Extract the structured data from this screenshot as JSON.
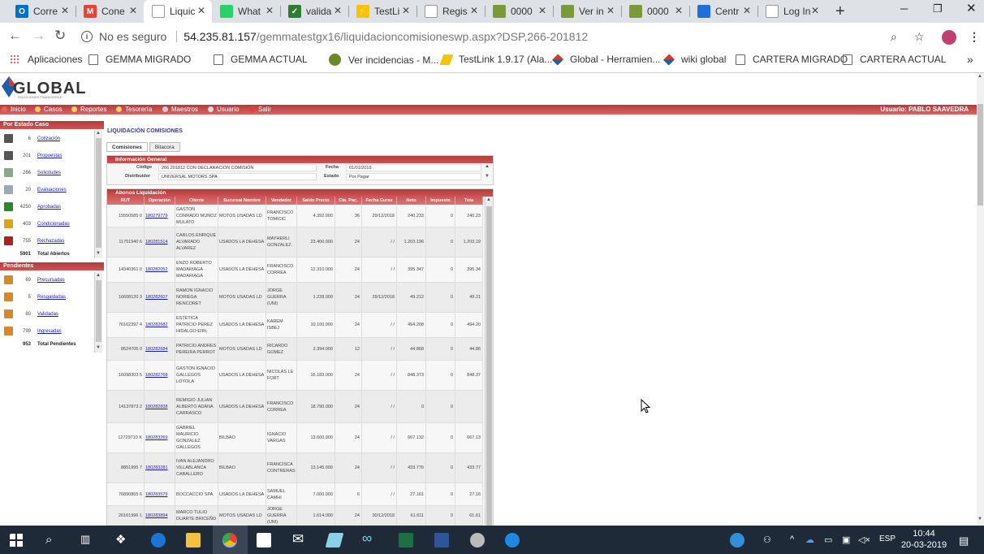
{
  "browser": {
    "tabs": [
      {
        "label": "Corre",
        "fav_color": "#0072c6",
        "fav_text": "O"
      },
      {
        "label": "Cone",
        "fav_color": "#ea4335",
        "fav_text": "M"
      },
      {
        "label": "Liquic",
        "fav_color": "#ffffff",
        "fav_text": "",
        "active": true
      },
      {
        "label": "What",
        "fav_color": "#25d366",
        "fav_text": ""
      },
      {
        "label": "valida",
        "fav_color": "#2e7d32",
        "fav_text": "✓"
      },
      {
        "label": "TestLi",
        "fav_color": "#f5c400",
        "fav_text": "⚡"
      },
      {
        "label": "Regis",
        "fav_color": "#ffffff",
        "fav_text": ""
      },
      {
        "label": "0000",
        "fav_color": "#7a9a3a",
        "fav_text": ""
      },
      {
        "label": "Ver in",
        "fav_color": "#7a9a3a",
        "fav_text": ""
      },
      {
        "label": "0000",
        "fav_color": "#7a9a3a",
        "fav_text": ""
      },
      {
        "label": "Centr",
        "fav_color": "#1e6fd9",
        "fav_text": ""
      },
      {
        "label": "Log In",
        "fav_color": "#ffffff",
        "fav_text": ""
      }
    ],
    "url_prefix": "No es seguro",
    "url_host": "54.235.81.157",
    "url_path": "/gemmatestgx16/liquidacioncomisioneswp.aspx?DSP,266-201812",
    "bookmarks": [
      {
        "label": "Aplicaciones",
        "icon": "apps-icon"
      },
      {
        "label": "GEMMA MIGRADO",
        "icon": "page-icon"
      },
      {
        "label": "GEMMA ACTUAL",
        "icon": "page-icon"
      },
      {
        "label": "Ver incidencias - M...",
        "icon": "mantis-icon"
      },
      {
        "label": "TestLink 1.9.17 (Ala...",
        "icon": "testlink-icon"
      },
      {
        "label": "Global - Herramien...",
        "icon": "global-icon"
      },
      {
        "label": "wiki global",
        "icon": "global-icon"
      },
      {
        "label": "CARTERA MIGRADO",
        "icon": "page-icon"
      },
      {
        "label": "CARTERA ACTUAL",
        "icon": "page-icon"
      }
    ]
  },
  "app": {
    "logo_text": "GLOBAL",
    "logo_sub": "SOLUCIONES FINANCIERAS",
    "menu": [
      "Inicio",
      "Casos",
      "Reportes",
      "Tesorería",
      "Maestros",
      "Usuario",
      "Salir"
    ],
    "user_label": "Usuario: PABLO SAAVEDRA"
  },
  "sidebar": {
    "estado_title": "Por Estado Caso",
    "estado_items": [
      {
        "count": "6",
        "label": "Cotización",
        "icon_color": "#555"
      },
      {
        "count": "201",
        "label": "Propuestas",
        "icon_color": "#555"
      },
      {
        "count": "266",
        "label": "Solicitudes",
        "icon_color": "#8a8"
      },
      {
        "count": "20",
        "label": "Evaluaciones",
        "icon_color": "#9ab"
      },
      {
        "count": "4250",
        "label": "Aprobadas",
        "icon_color": "#2a8a2a"
      },
      {
        "count": "403",
        "label": "Condicionadas",
        "icon_color": "#d9a520"
      },
      {
        "count": "755",
        "label": "Rechazadas",
        "icon_color": "#b02020"
      }
    ],
    "estado_total_count": "5901",
    "estado_total_label": "Total Abiertos",
    "pend_title": "Pendientes",
    "pend_items": [
      {
        "count": "69",
        "label": "Precursadas",
        "icon_color": "#d8872a"
      },
      {
        "count": "5",
        "label": "Resgaldadas",
        "icon_color": "#d8872a"
      },
      {
        "count": "80",
        "label": "Validadas",
        "icon_color": "#d8872a"
      },
      {
        "count": "799",
        "label": "Ingresadas",
        "icon_color": "#d8872a"
      }
    ],
    "pend_total_count": "953",
    "pend_total_label": "Total Pendientes"
  },
  "main": {
    "title": "LIQUIDACIÓN COMISIONES",
    "tabs": [
      "Comisiones",
      "Bitacora"
    ],
    "info_title": "Información General",
    "codigo_label": "Código",
    "codigo_value": "266 201812 CON DECLARACIÓN COMISIÓN",
    "fecha_label": "Fecha",
    "fecha_value": "01/01/2019",
    "distribuidor_label": "Distribuidor",
    "distribuidor_value": "UNIVERSAL MOTORS SPA",
    "estado_label": "Estado",
    "estado_value": "Por Pagar",
    "abonos_title": "Abonos Liquidación",
    "columns": [
      "RUT",
      "Operación",
      "Cliente",
      "Sucursal Nombre",
      "Vendedor",
      "Saldo Precio",
      "Cta. Pac.",
      "Fecha Curse",
      "Neto",
      "Impuesto",
      "Tota"
    ],
    "rows": [
      {
        "rut": "15550585 0",
        "op": "180279779",
        "cliente": "GASTON CONRADO MUNOZ MULATO",
        "suc": "MOTOS USADAS LD",
        "vend": "FRANCISCO TOMICIC",
        "saldo": "4.392.000",
        "cta": "36",
        "fecha": "29/12/2018",
        "neto": "240.233",
        "imp": "0",
        "tot": "240.23"
      },
      {
        "rut": "11751940 6",
        "op": "180281514",
        "cliente": "CARLOS ENRIQUE ALVARADO ALVAREZ",
        "suc": "USADOS LA DEHESA",
        "vend": "MAYHERLI GONZALEZ.",
        "saldo": "23.400.000",
        "cta": "24",
        "fecha": "/ /",
        "neto": "1.203.196",
        "imp": "0",
        "tot": "1.203.19"
      },
      {
        "rut": "14340361 0",
        "op": "180282052",
        "cliente": "ENZO ROBERTO MADARIAGA MADARIAGA",
        "suc": "USADOS LA DEHESA",
        "vend": "FRANCISCO CORREA",
        "saldo": "12.310.000",
        "cta": "24",
        "fecha": "/ /",
        "neto": "395.347",
        "imp": "0",
        "tot": "395.34"
      },
      {
        "rut": "16608120 3",
        "op": "180282607",
        "cliente": "RAMON IGNACIO NORIEGA RENCORET",
        "suc": "MOTOS USADAS LD",
        "vend": "JORGE GUERRA (UNI)",
        "saldo": "1.228.000",
        "cta": "24",
        "fecha": "29/12/2018",
        "neto": "49.212",
        "imp": "0",
        "tot": "49.21"
      },
      {
        "rut": "76162397 4",
        "op": "180282682",
        "cliente": "ESTETICA PATRICIO PEREZ HIDALGO EIRL",
        "suc": "USADOS LA DEHESA",
        "vend": "KAREM ISBEJ",
        "saldo": "10.100.000",
        "cta": "24",
        "fecha": "/ /",
        "neto": "494.208",
        "imp": "0",
        "tot": "494.20"
      },
      {
        "rut": "8524705 0",
        "op": "180282684",
        "cliente": "PATRICIO ANDRES PEREIRA PERROT",
        "suc": "MOTOS USADAS LD",
        "vend": "RICARDO GOMEZ",
        "saldo": "2.394.000",
        "cta": "12",
        "fecha": "/ /",
        "neto": "44.868",
        "imp": "0",
        "tot": "44.86"
      },
      {
        "rut": "16098303 5",
        "op": "180282768",
        "cliente": "GASTON IGNACIO GALLEGOS LOYOLA",
        "suc": "USADOS LA DEHESA",
        "vend": "NICOLAS LE FORT",
        "saldo": "16.183.000",
        "cta": "24",
        "fecha": "/ /",
        "neto": "848.373",
        "imp": "0",
        "tot": "848.37"
      },
      {
        "rut": "14137873 2",
        "op": "180282838",
        "cliente": "REMIGIO JULIAN ALBERTO ADANA CARRASCO",
        "suc": "USADOS LA DEHESA",
        "vend": "FRANCISCO CORREA",
        "saldo": "18.790.000",
        "cta": "24",
        "fecha": "/ /",
        "neto": "0",
        "imp": "0",
        "tot": ""
      },
      {
        "rut": "12729710 K",
        "op": "180283269",
        "cliente": "GABRIEL MAURICIO GONZALEZ GALLEGOS",
        "suc": "BILBAO",
        "vend": "IGNACIO VARGAS",
        "saldo": "13.600.000",
        "cta": "24",
        "fecha": "/ /",
        "neto": "667.132",
        "imp": "0",
        "tot": "667.13"
      },
      {
        "rut": "8851995 7",
        "op": "180283281",
        "cliente": "IVAN ALEJANDRO VILLABLANCA CABALLERO",
        "suc": "BILBAO",
        "vend": "FRANCISCA CONTRERAS",
        "saldo": "13.145.000",
        "cta": "24",
        "fecha": "/ /",
        "neto": "433.776",
        "imp": "0",
        "tot": "433.77"
      },
      {
        "rut": "76890865 6",
        "op": "180283579",
        "cliente": "BOCCACCIO SPA",
        "suc": "USADOS LA DEHESA",
        "vend": "SAMUEL CAMHI",
        "saldo": "7.000.000",
        "cta": "6",
        "fecha": "/ /",
        "neto": "27.161",
        "imp": "0",
        "tot": "27.16"
      },
      {
        "rut": "26161996 1",
        "op": "180283894",
        "cliente": "MARCO TULIO DUARTE BRICEÑO",
        "suc": "MOTOS USADAS LD",
        "vend": "JORGE GUERRA (UNI)",
        "saldo": "1.614.000",
        "cta": "24",
        "fecha": "30/12/2018",
        "neto": "61.611",
        "imp": "0",
        "tot": "61.61"
      }
    ]
  },
  "taskbar": {
    "lang": "ESP",
    "time": "10:44",
    "date": "20-03-2019"
  }
}
